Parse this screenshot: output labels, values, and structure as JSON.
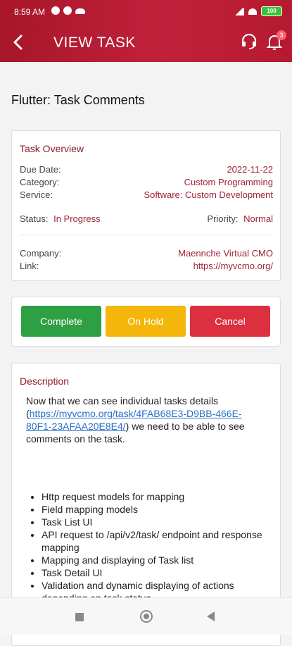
{
  "status_bar": {
    "time": "8:59 AM",
    "battery": "100"
  },
  "app_bar": {
    "title": "VIEW TASK",
    "notification_count": "3"
  },
  "task": {
    "title": "Flutter: Task Comments"
  },
  "overview": {
    "heading": "Task Overview",
    "due_date_label": "Due Date:",
    "due_date": "2022-11-22",
    "category_label": "Category:",
    "category": "Custom Programming",
    "service_label": "Service:",
    "service": "Software: Custom Development",
    "status_label": "Status:",
    "status": "In Progress",
    "priority_label": "Priority:",
    "priority": "Normal",
    "company_label": "Company:",
    "company": "Maennche Virtual CMO",
    "link_label": "Link:",
    "link": "https://myvcmo.org/"
  },
  "actions": {
    "complete": "Complete",
    "on_hold": "On Hold",
    "cancel": "Cancel"
  },
  "description": {
    "heading": "Description",
    "intro_before": "Now that we can see individual tasks details (",
    "intro_link": "https://myvcmo.org/task/4FAB68E3-D9BB-466E-80F1-23AFAA20E8E4/",
    "intro_after": ") we need to be able to see comments on the task.",
    "items": [
      "Http request models for mapping",
      "Field mapping models",
      "Task List UI",
      "API request to /api/v2/task/ endpoint and response mapping",
      "Mapping and displaying of Task list",
      "Task Detail UI",
      "Validation and dynamic displaying of actions depending on task status"
    ]
  },
  "colors": {
    "brand": "#b51a30",
    "accent_text": "#a0233a",
    "complete": "#2da044",
    "on_hold": "#f4b60a",
    "cancel": "#dc3041",
    "link": "#2a6fc7"
  }
}
